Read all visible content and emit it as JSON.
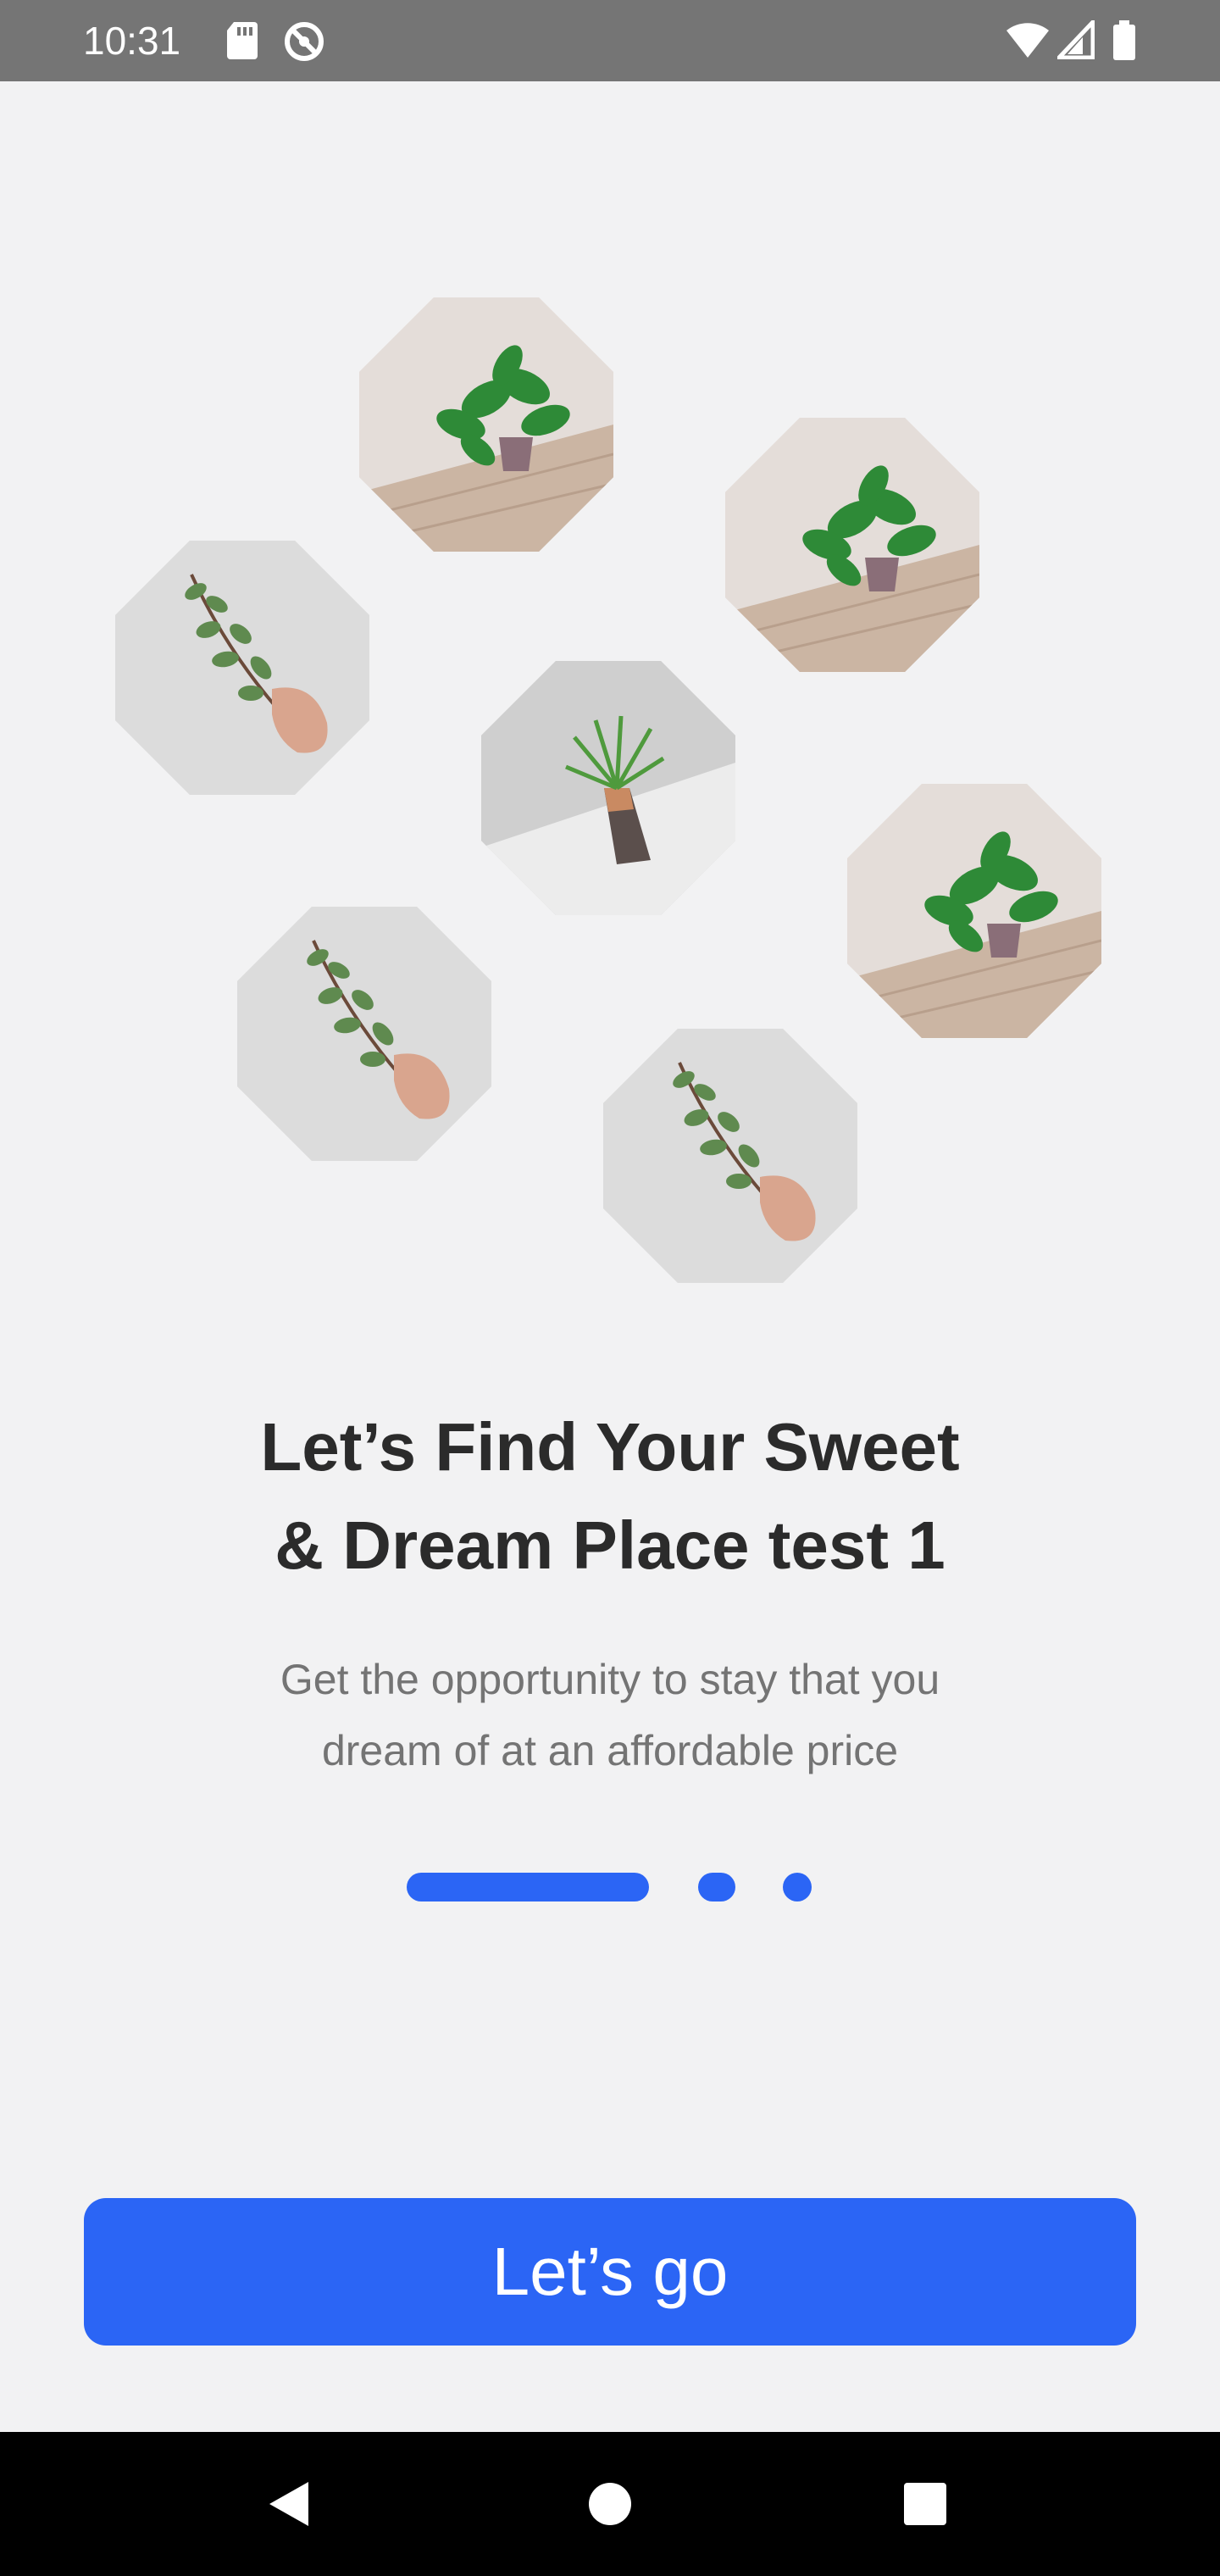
{
  "status_bar": {
    "time": "10:31",
    "left_icons": [
      "sd-card-icon",
      "no-disturb-icon"
    ],
    "right_icons": [
      "wifi-icon",
      "cellular-signal-icon",
      "battery-icon"
    ]
  },
  "collage": {
    "tiles": [
      {
        "name": "plant-tile-pothos-top",
        "image": "potted-pothos-on-wooden-table"
      },
      {
        "name": "plant-tile-pothos-right",
        "image": "potted-pothos-on-wooden-table"
      },
      {
        "name": "plant-tile-eucalyptus-left",
        "image": "hand-holding-eucalyptus-branch"
      },
      {
        "name": "plant-tile-vase-center",
        "image": "air-plant-in-cone-vase"
      },
      {
        "name": "plant-tile-pothos-far-right",
        "image": "potted-pothos-on-wooden-table"
      },
      {
        "name": "plant-tile-eucalyptus-bottom-left",
        "image": "hand-holding-eucalyptus-branch"
      },
      {
        "name": "plant-tile-eucalyptus-bottom",
        "image": "hand-holding-eucalyptus-branch"
      }
    ]
  },
  "onboarding": {
    "title_line1": "Let’s Find Your Sweet",
    "title_line2": "& Dream Place test 1",
    "subtitle_line1": "Get the opportunity to stay that you",
    "subtitle_line2": "dream of at an affordable price",
    "pager": {
      "total_pages": 3,
      "current_page": 1
    },
    "cta_label": "Let’s go"
  },
  "nav_bar": {
    "buttons": [
      "back-icon",
      "home-icon",
      "recents-icon"
    ]
  },
  "colors": {
    "accent": "#2b65f5",
    "background": "#f2f2f3",
    "title": "#2b2b2b",
    "subtitle": "#747474",
    "status_bar": "#757575",
    "nav_bar": "#000000"
  }
}
